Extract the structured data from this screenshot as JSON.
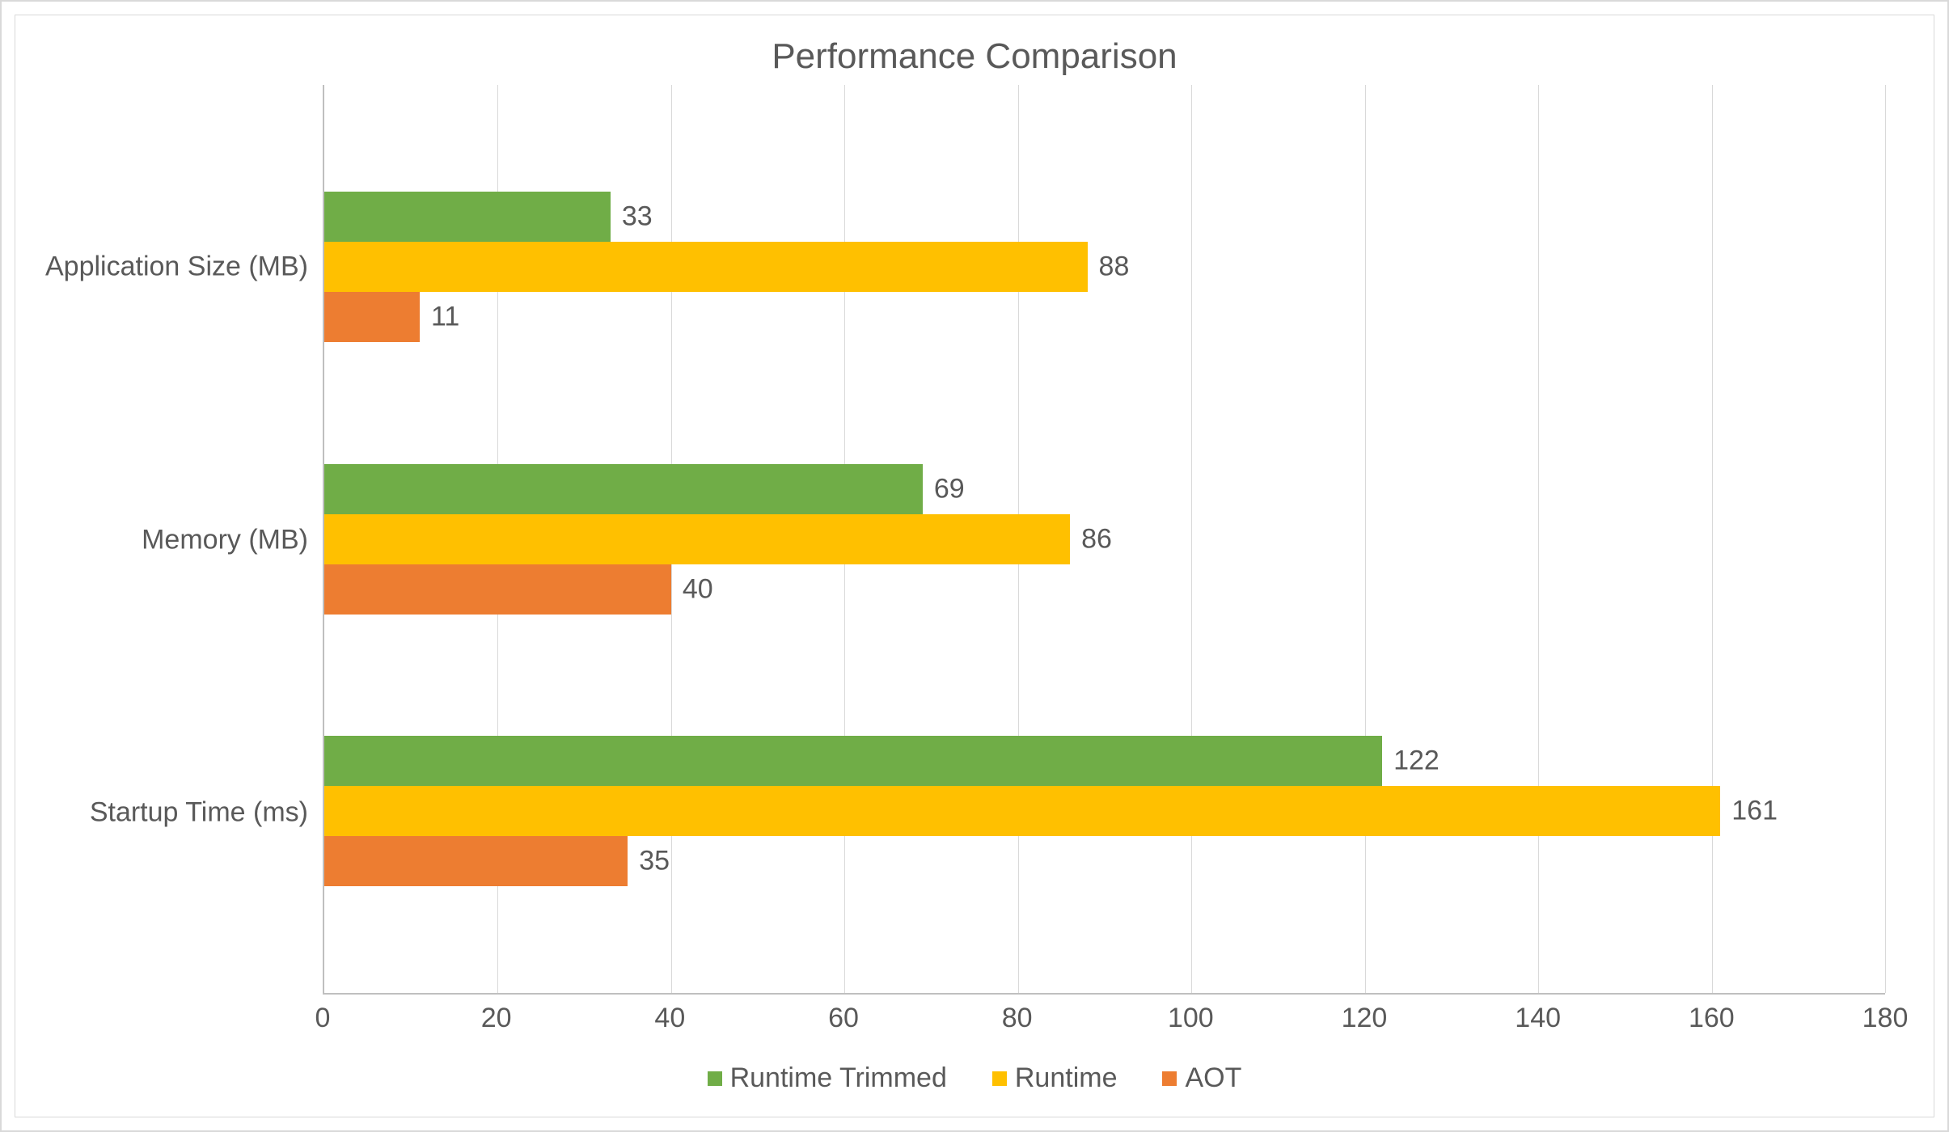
{
  "chart_data": {
    "type": "bar",
    "orientation": "horizontal",
    "title": "Performance Comparison",
    "xlabel": "",
    "ylabel": "",
    "xlim": [
      0,
      180
    ],
    "xticks": [
      0,
      20,
      40,
      60,
      80,
      100,
      120,
      140,
      160,
      180
    ],
    "categories": [
      "Startup Time (ms)",
      "Memory (MB)",
      "Application Size (MB)"
    ],
    "series": [
      {
        "name": "Runtime Trimmed",
        "color": "#70ad47",
        "values": [
          122,
          69,
          33
        ]
      },
      {
        "name": "Runtime",
        "color": "#ffc000",
        "values": [
          161,
          86,
          88
        ]
      },
      {
        "name": "AOT",
        "color": "#ed7d31",
        "values": [
          35,
          40,
          11
        ]
      }
    ],
    "grid": true,
    "legend_position": "bottom"
  }
}
